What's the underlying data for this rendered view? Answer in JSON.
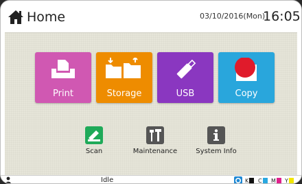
{
  "header": {
    "home_label": "Home",
    "date": "03/10/2016(Mon)",
    "time": "16:05"
  },
  "tiles": [
    {
      "label": "Print",
      "icon": "print-icon",
      "color": "#d058b2"
    },
    {
      "label": "Storage",
      "icon": "storage-folder-icon",
      "color": "#ee8c00"
    },
    {
      "label": "USB",
      "icon": "usb-drive-icon",
      "color": "#8a37c0"
    },
    {
      "label": "Copy",
      "icon": "copy-icon",
      "color": "#29a6dc"
    }
  ],
  "apps": [
    {
      "label": "Scan",
      "icon": "scan-icon",
      "color": "#1faa59"
    },
    {
      "label": "Maintenance",
      "icon": "maintenance-tools-icon",
      "color": "#555555"
    },
    {
      "label": "System Info",
      "icon": "info-icon",
      "color": "#555555"
    }
  ],
  "status": {
    "text": "Idle",
    "ink": [
      {
        "letter": "K",
        "color": "#111111"
      },
      {
        "letter": "C",
        "color": "#2aa8e0"
      },
      {
        "letter": "M",
        "color": "#e0208c"
      },
      {
        "letter": "Y",
        "color": "#f2e600"
      }
    ]
  }
}
